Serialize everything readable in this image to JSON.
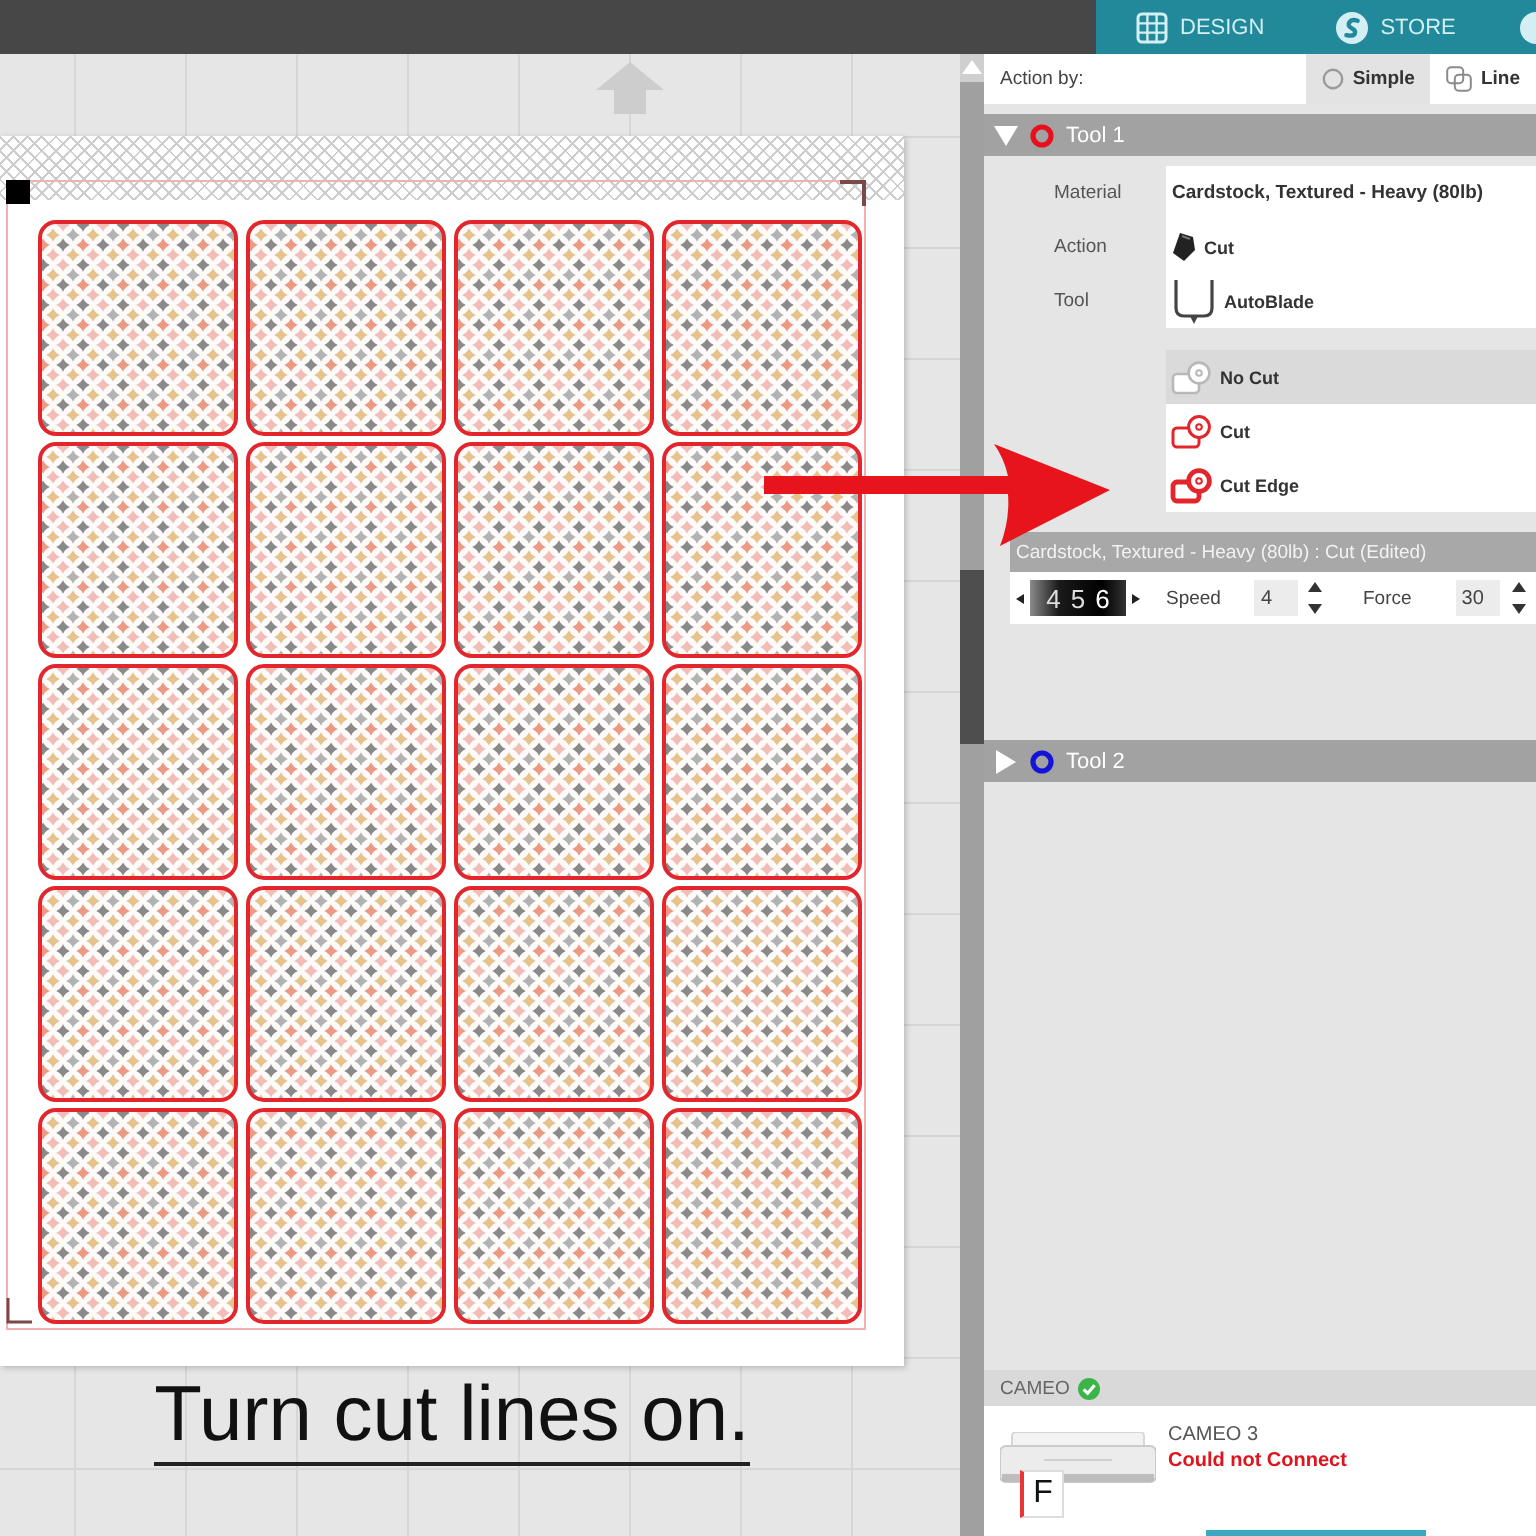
{
  "top_tabs": [
    {
      "label": "DESIGN",
      "selected": false
    },
    {
      "label": "STORE",
      "selected": false
    },
    {
      "selected": false
    }
  ],
  "canvas": {
    "tiles": [
      {
        "cut_line": true
      },
      {
        "cut_line": true
      },
      {
        "cut_line": true
      },
      {
        "cut_line": true
      },
      {
        "cut_line": true
      },
      {
        "cut_line": true
      },
      {
        "cut_line": true
      },
      {
        "cut_line": true
      },
      {
        "cut_line": true
      },
      {
        "cut_line": true
      },
      {
        "cut_line": true
      },
      {
        "cut_line": true
      },
      {
        "cut_line": true
      },
      {
        "cut_line": true
      },
      {
        "cut_line": true
      },
      {
        "cut_line": true
      },
      {
        "cut_line": true
      },
      {
        "cut_line": true
      },
      {
        "cut_line": true
      },
      {
        "cut_line": true
      }
    ]
  },
  "caption": "Turn cut lines on.",
  "panel": {
    "action_by": {
      "label": "Action by:",
      "modes": [
        {
          "label": "Simple",
          "selected": true
        },
        {
          "label": "Line",
          "selected": false
        }
      ]
    },
    "tools": [
      {
        "name": "Tool 1",
        "color": "#e8101c",
        "expanded": true,
        "fields": [
          {
            "kind": "text",
            "label": "Material",
            "value": "Cardstock, Textured - Heavy (80lb)"
          },
          {
            "kind": "blade",
            "label": "Action",
            "value": "Cut"
          },
          {
            "kind": "autoblade",
            "label": "Tool",
            "value": "AutoBlade"
          }
        ],
        "cut_options": [
          {
            "kind": "none",
            "label": "No Cut",
            "selected": true
          },
          {
            "kind": "cut",
            "label": "Cut",
            "selected": false
          },
          {
            "kind": "edge",
            "label": "Cut Edge",
            "selected": false
          }
        ],
        "settings_title": "Cardstock, Textured - Heavy (80lb) : Cut (Edited)",
        "blade_depth": [
          "4",
          "5",
          "6"
        ],
        "speed": {
          "label": "Speed",
          "value": "4"
        },
        "force": {
          "label": "Force",
          "value": "30"
        }
      },
      {
        "name": "Tool 2",
        "color": "#1414d8",
        "expanded": false
      }
    ]
  },
  "device": {
    "header": "CAMEO",
    "ok": true,
    "badge": "F",
    "model": "CAMEO 3",
    "status": "Could not Connect"
  }
}
